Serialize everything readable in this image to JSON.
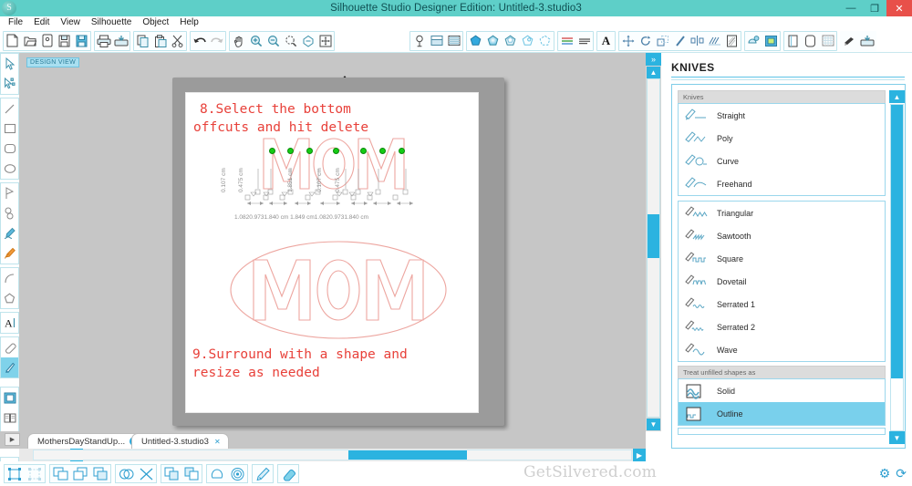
{
  "window": {
    "title": "Silhouette Studio Designer Edition: Untitled-3.studio3",
    "logo_glyph": "S",
    "controls": [
      {
        "name": "minimize",
        "glyph": "—"
      },
      {
        "name": "maximize",
        "glyph": "❐"
      },
      {
        "name": "close",
        "glyph": "✕"
      }
    ],
    "accent_color": "#5ecfc8",
    "close_color": "#e8504a"
  },
  "menubar": {
    "items": [
      "File",
      "Edit",
      "View",
      "Silhouette",
      "Object",
      "Help"
    ]
  },
  "toolbar": {
    "groups": [
      {
        "name": "file-group",
        "icons": [
          {
            "name": "new-document-icon",
            "glyph": "὜B"
          },
          {
            "name": "open-folder-icon",
            "glyph": "open"
          },
          {
            "name": "open-recent-icon",
            "glyph": "recent"
          },
          {
            "name": "save-icon",
            "glyph": "save"
          },
          {
            "name": "save-as-icon",
            "glyph": "saveas"
          }
        ]
      },
      {
        "name": "print-group",
        "icons": [
          {
            "name": "print-icon",
            "glyph": "print"
          },
          {
            "name": "send-to-silhouette-icon",
            "glyph": "send"
          }
        ]
      },
      {
        "name": "clipboard-group",
        "icons": [
          {
            "name": "copy-icon",
            "glyph": "copy"
          },
          {
            "name": "paste-icon",
            "glyph": "paste"
          },
          {
            "name": "cut-icon",
            "glyph": "cut"
          }
        ]
      },
      {
        "name": "history-group",
        "icons": [
          {
            "name": "undo-icon",
            "glyph": "undo"
          },
          {
            "name": "redo-icon",
            "glyph": "redo"
          }
        ]
      },
      {
        "name": "view-group",
        "icons": [
          {
            "name": "pan-hand-icon",
            "glyph": "hand"
          },
          {
            "name": "zoom-in-icon",
            "glyph": "zoomin"
          },
          {
            "name": "zoom-out-icon",
            "glyph": "zoomout"
          },
          {
            "name": "zoom-selection-icon",
            "glyph": "zoomsel"
          },
          {
            "name": "zoom-region-icon",
            "glyph": "zoomregion"
          },
          {
            "name": "fit-to-window-icon",
            "glyph": "fit"
          }
        ]
      },
      {
        "name": "page-setup-group",
        "icons": [
          {
            "name": "page-setup-icon",
            "glyph": "pagesetup"
          },
          {
            "name": "cut-settings-icon",
            "glyph": "cutsettings"
          },
          {
            "name": "registration-marks-icon",
            "glyph": "regmarks"
          }
        ]
      },
      {
        "name": "fill-group",
        "icons": [
          {
            "name": "fill-color-icon",
            "glyph": "fillcolor"
          },
          {
            "name": "fill-gradient-icon",
            "glyph": "fillgradient"
          },
          {
            "name": "fill-pattern-icon",
            "glyph": "fillpattern"
          },
          {
            "name": "line-color-icon",
            "glyph": "linecolor"
          },
          {
            "name": "line-style-icon",
            "glyph": "linestyle"
          }
        ]
      },
      {
        "name": "text-style-group",
        "icons": [
          {
            "name": "text-style-icon",
            "glyph": "textstyle"
          },
          {
            "name": "paragraph-icon",
            "glyph": "paragraph"
          }
        ]
      },
      {
        "name": "text-group",
        "icons": [
          {
            "name": "text-tool-icon",
            "glyph": "A"
          }
        ]
      },
      {
        "name": "transform-group",
        "icons": [
          {
            "name": "move-icon",
            "glyph": "move"
          },
          {
            "name": "rotate-icon",
            "glyph": "rotate"
          },
          {
            "name": "scale-icon",
            "glyph": "scale"
          },
          {
            "name": "shear-icon",
            "glyph": "shear"
          },
          {
            "name": "align-icon",
            "glyph": "align"
          },
          {
            "name": "replicate-icon",
            "glyph": "replicate"
          },
          {
            "name": "nest-icon",
            "glyph": "nest"
          }
        ]
      },
      {
        "name": "effects-group",
        "icons": [
          {
            "name": "offset-icon",
            "glyph": "offset"
          },
          {
            "name": "trace-icon",
            "glyph": "trace"
          }
        ]
      },
      {
        "name": "library-group",
        "icons": [
          {
            "name": "cut-style-icon",
            "glyph": "cutstyle"
          },
          {
            "name": "print-bleed-icon",
            "glyph": "bleed"
          },
          {
            "name": "grid-icon",
            "glyph": "grid"
          }
        ]
      },
      {
        "name": "knife-group",
        "icons": [
          {
            "name": "knife-tool-icon",
            "glyph": "knife"
          },
          {
            "name": "send-panel-icon",
            "glyph": "sendpanel"
          }
        ]
      }
    ]
  },
  "left_toolbar": {
    "groups": [
      {
        "name": "select-group",
        "tools": [
          {
            "name": "select-tool",
            "selected": false
          },
          {
            "name": "edit-points-tool",
            "selected": false
          }
        ]
      },
      {
        "name": "draw-group",
        "tools": [
          {
            "name": "line-tool",
            "selected": false
          },
          {
            "name": "rectangle-tool",
            "selected": false
          },
          {
            "name": "rounded-rectangle-tool",
            "selected": false
          },
          {
            "name": "ellipse-tool",
            "selected": false
          }
        ]
      },
      {
        "name": "polygon-group",
        "tools": [
          {
            "name": "polygon-tool",
            "selected": false
          },
          {
            "name": "curve-tool",
            "selected": false
          },
          {
            "name": "freehand-tool",
            "selected": false
          },
          {
            "name": "smooth-freehand-tool",
            "selected": false
          }
        ]
      },
      {
        "name": "arc-group",
        "tools": [
          {
            "name": "arc-tool",
            "selected": false
          },
          {
            "name": "regular-polygon-tool",
            "selected": false
          }
        ]
      },
      {
        "name": "text-group",
        "tools": [
          {
            "name": "text-tool",
            "selected": false
          }
        ]
      },
      {
        "name": "eraser-group",
        "tools": [
          {
            "name": "eraser-tool",
            "selected": false
          },
          {
            "name": "knife-tool",
            "selected": true
          }
        ]
      },
      {
        "name": "panel-group",
        "tools": [
          {
            "name": "page-tool",
            "selected": false
          },
          {
            "name": "library-tool",
            "selected": false
          },
          {
            "name": "store-tool",
            "selected": false
          }
        ]
      },
      {
        "name": "expand-group",
        "tools": [
          {
            "name": "expand-toolbar-button",
            "selected": false
          }
        ]
      }
    ]
  },
  "canvas": {
    "design_view_label": "DESIGN VIEW",
    "annotations": [
      {
        "name": "step-8-text",
        "lines": [
          "8.Select the bottom",
          "offcuts and hit delete"
        ],
        "color": "#e8413a"
      },
      {
        "name": "step-9-text",
        "lines": [
          "9.Surround with a shape and",
          "resize as needed"
        ],
        "color": "#e8413a"
      }
    ],
    "artwork": {
      "top_word": "MOM",
      "bottom_word": "MOM",
      "outline_color": "#eda6a0",
      "handle_color": "#15cc15",
      "handle_count": 7
    },
    "dimensions": {
      "vertical_labels": [
        "0.107 cm",
        "0.475 cm",
        "1.851 cm",
        "0.107 cm",
        "0.475 cm"
      ],
      "bottom_labels": [
        "1.082 cm",
        "0.973 cm",
        "1.840 cm",
        "1.849 cm",
        "1.082 cm",
        "0.973 cm",
        "1.840 cm"
      ],
      "bottom_line": "1.0820.9731.840 cm 1.849 cm1.0820.9731.840 cm",
      "color": "#8f8f8f"
    },
    "scrollbars": {
      "vertical_name": "canvas-vertical-scrollbar",
      "horizontal_name": "canvas-horizontal-scrollbar",
      "collapse_glyph": "»"
    }
  },
  "tabs": {
    "prev_glyph": "▶",
    "items": [
      {
        "label": "MothersDayStandUp...",
        "active": false,
        "close": "✕"
      },
      {
        "label": "Untitled-3.studio3",
        "active": true,
        "close": "✕"
      }
    ]
  },
  "right_panel": {
    "title": "KNIVES",
    "sections": [
      {
        "header": "Knives",
        "items": [
          {
            "label": "Straight",
            "icon": "knife-straight-icon",
            "selected": false
          },
          {
            "label": "Poly",
            "icon": "knife-poly-icon",
            "selected": false
          },
          {
            "label": "Curve",
            "icon": "knife-curve-icon",
            "selected": false
          },
          {
            "label": "Freehand",
            "icon": "knife-freehand-icon",
            "selected": false
          }
        ]
      },
      {
        "header": "",
        "items": [
          {
            "label": "Triangular",
            "icon": "knife-triangular-icon",
            "selected": false
          },
          {
            "label": "Sawtooth",
            "icon": "knife-sawtooth-icon",
            "selected": false
          },
          {
            "label": "Square",
            "icon": "knife-square-icon",
            "selected": false
          },
          {
            "label": "Dovetail",
            "icon": "knife-dovetail-icon",
            "selected": false
          },
          {
            "label": "Serrated 1",
            "icon": "knife-serrated1-icon",
            "selected": false
          },
          {
            "label": "Serrated 2",
            "icon": "knife-serrated2-icon",
            "selected": false
          },
          {
            "label": "Wave",
            "icon": "knife-wave-icon",
            "selected": false
          }
        ]
      },
      {
        "header": "Treat unfilled shapes as",
        "items": [
          {
            "label": "Solid",
            "icon": "treat-solid-icon",
            "selected": false
          },
          {
            "label": "Outline",
            "icon": "treat-outline-icon",
            "selected": true
          }
        ]
      }
    ],
    "selection_color": "#79d0ec"
  },
  "bottom_bar": {
    "groups": [
      {
        "name": "group-tools",
        "icons": [
          {
            "name": "group-icon"
          },
          {
            "name": "ungroup-icon"
          }
        ]
      },
      {
        "name": "compound-tools",
        "icons": [
          {
            "name": "make-compound-path-icon"
          },
          {
            "name": "bring-to-front-icon"
          },
          {
            "name": "send-to-back-icon"
          }
        ]
      },
      {
        "name": "boolean-tools",
        "icons": [
          {
            "name": "weld-icon"
          },
          {
            "name": "subtract-icon"
          }
        ]
      },
      {
        "name": "arrange-tools",
        "icons": [
          {
            "name": "duplicate-icon"
          },
          {
            "name": "replicate-icon"
          }
        ]
      },
      {
        "name": "effect-tools",
        "icons": [
          {
            "name": "offset-icon"
          },
          {
            "name": "inner-offset-icon"
          }
        ]
      },
      {
        "name": "pen-tools",
        "icons": [
          {
            "name": "sketch-pen-icon"
          }
        ]
      },
      {
        "name": "eraser-tools",
        "icons": [
          {
            "name": "eraser-icon"
          }
        ]
      }
    ],
    "watermark": "GetSilvered.com",
    "right_icons": [
      {
        "name": "settings-gear-icon",
        "glyph": "⚙"
      },
      {
        "name": "sync-refresh-icon",
        "glyph": "⟳"
      }
    ]
  }
}
